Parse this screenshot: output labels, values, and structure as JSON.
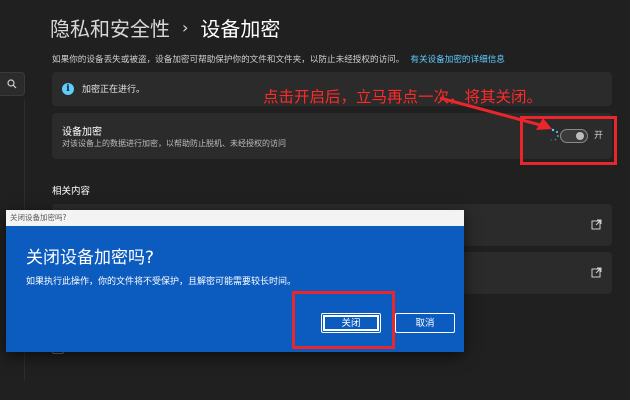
{
  "breadcrumb": {
    "parent": "隐私和安全性",
    "separator": "›",
    "current": "设备加密"
  },
  "description": {
    "text": "如果你的设备丢失或被盗，设备加密可帮助保护你的文件和文件夹，以防止未经授权的访问。",
    "link": "有关设备加密的详细信息"
  },
  "status": {
    "text": "加密正在进行。",
    "icon": "info-icon"
  },
  "encryption": {
    "title": "设备加密",
    "subtitle": "对该设备上的数据进行加密，以帮助防止脱机、未经授权的访问",
    "toggle_state_label": "开",
    "toggle_on": true
  },
  "related": {
    "title": "相关内容"
  },
  "annotation": {
    "text": "点击开启后，立马再点一次，将其关闭。",
    "color": "#ff2a2a"
  },
  "dialog": {
    "window_title": "关闭设备加密吗?",
    "heading": "关闭设备加密吗?",
    "message": "如果执行此操作，你的文件将不受保护，且解密可能需要较长时间。",
    "confirm_label": "关闭",
    "cancel_label": "取消",
    "background": "#0c5bbf"
  },
  "colors": {
    "accent": "#60cdff",
    "background": "#202020",
    "card": "#2b2b2b",
    "highlight_box": "#e8262b"
  }
}
